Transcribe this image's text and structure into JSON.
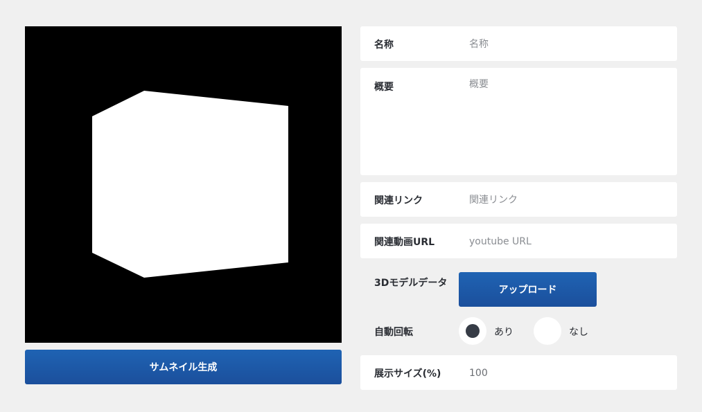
{
  "viewer": {
    "thumbnail_button_label": "サムネイル生成"
  },
  "form": {
    "name": {
      "label": "名称",
      "placeholder": "名称",
      "value": ""
    },
    "summary": {
      "label": "概要",
      "placeholder": "概要",
      "value": ""
    },
    "related_link": {
      "label": "関連リンク",
      "placeholder": "関連リンク",
      "value": ""
    },
    "video_url": {
      "label": "関連動画URL",
      "placeholder": "youtube URL",
      "value": ""
    },
    "model_data": {
      "label": "3Dモデルデータ",
      "upload_label": "アップロード"
    },
    "auto_rotate": {
      "label": "自動回転",
      "options": [
        {
          "label": "あり",
          "selected": true
        },
        {
          "label": "なし",
          "selected": false
        }
      ]
    },
    "display_size": {
      "label": "展示サイズ(%)",
      "value": "100"
    }
  },
  "colors": {
    "accent": "#1b5aa8",
    "background": "#f0f0f0",
    "radio_dot": "#363c46"
  }
}
